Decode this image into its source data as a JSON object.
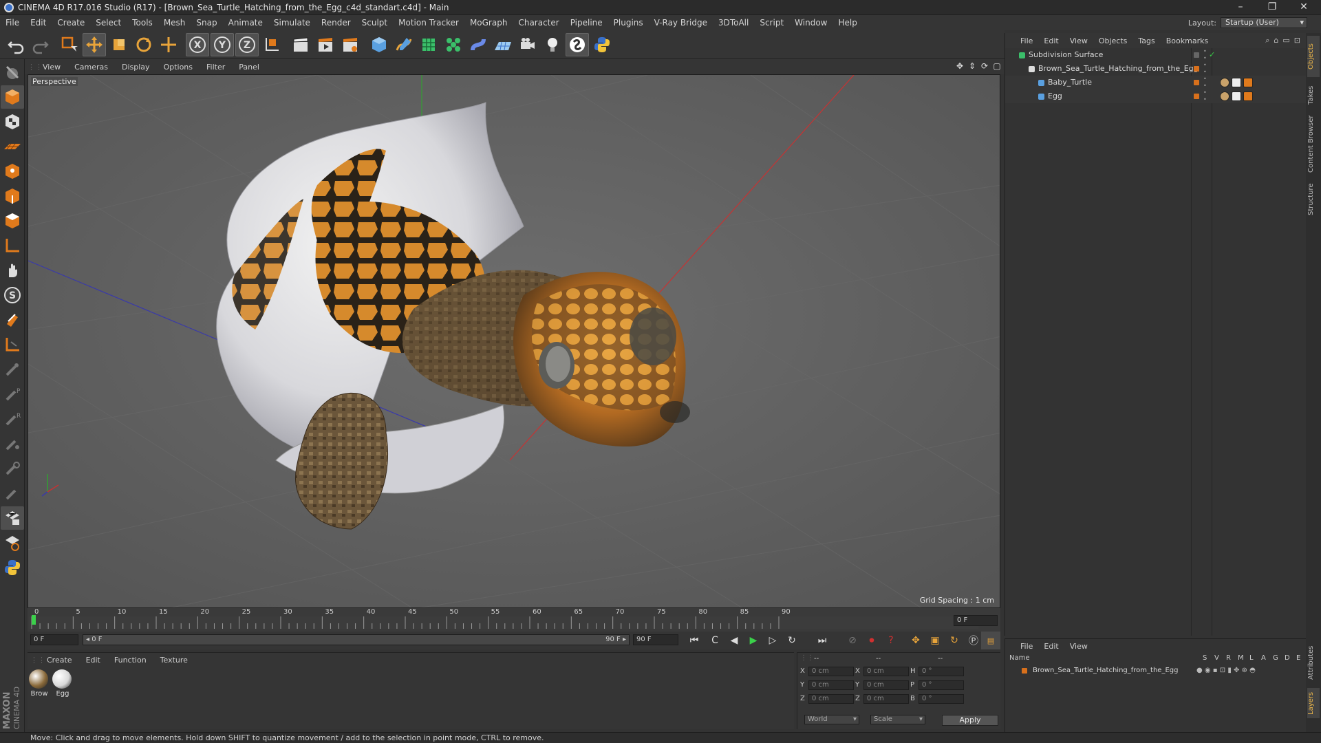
{
  "window": {
    "title": "CINEMA 4D R17.016 Studio (R17) - [Brown_Sea_Turtle_Hatching_from_the_Egg_c4d_standart.c4d] - Main",
    "minimize": "–",
    "maximize": "❐",
    "close": "✕"
  },
  "menubar": {
    "items": [
      "File",
      "Edit",
      "Create",
      "Select",
      "Tools",
      "Mesh",
      "Snap",
      "Animate",
      "Simulate",
      "Render",
      "Sculpt",
      "Motion Tracker",
      "MoGraph",
      "Character",
      "Pipeline",
      "Plugins",
      "V-Ray Bridge",
      "3DToAll",
      "Script",
      "Window",
      "Help"
    ],
    "layout_label": "Layout:",
    "layout_value": "Startup (User)"
  },
  "viewport": {
    "menu": [
      "View",
      "Cameras",
      "Display",
      "Options",
      "Filter",
      "Panel"
    ],
    "label": "Perspective",
    "grid_spacing": "Grid Spacing : 1 cm"
  },
  "timeline": {
    "ticks": [
      "0",
      "5",
      "10",
      "15",
      "20",
      "25",
      "30",
      "35",
      "40",
      "45",
      "50",
      "55",
      "60",
      "65",
      "70",
      "75",
      "80",
      "85",
      "90"
    ],
    "current_frame": "0 F",
    "start_field": "0 F",
    "range_start": "◂ 0 F",
    "range_end": "90 F ▸",
    "end_field": "90 F"
  },
  "materials": {
    "menu": [
      "Create",
      "Edit",
      "Function",
      "Texture"
    ],
    "items": [
      {
        "label": "Brow",
        "color": "#8a6a3a"
      },
      {
        "label": "Egg",
        "color": "#d8d8d8"
      }
    ]
  },
  "coords": {
    "header": [
      "--",
      "--",
      "--"
    ],
    "rows": [
      {
        "a": "X",
        "av": "0 cm",
        "b": "X",
        "bv": "0 cm",
        "c": "H",
        "cv": "0 °"
      },
      {
        "a": "Y",
        "av": "0 cm",
        "b": "Y",
        "bv": "0 cm",
        "c": "P",
        "cv": "0 °"
      },
      {
        "a": "Z",
        "av": "0 cm",
        "b": "Z",
        "bv": "0 cm",
        "c": "B",
        "cv": "0 °"
      }
    ],
    "space": "World",
    "mode": "Scale",
    "apply": "Apply"
  },
  "objects": {
    "menu": [
      "File",
      "Edit",
      "View",
      "Objects",
      "Tags",
      "Bookmarks"
    ],
    "tree": [
      {
        "name": "Subdivision Surface",
        "indent": 0
      },
      {
        "name": "Brown_Sea_Turtle_Hatching_from_the_Egg",
        "indent": 1
      },
      {
        "name": "Baby_Turtle",
        "indent": 2
      },
      {
        "name": "Egg",
        "indent": 2
      }
    ]
  },
  "layers": {
    "menu": [
      "File",
      "Edit",
      "View"
    ],
    "columns": [
      "Name",
      "S",
      "V",
      "R",
      "M",
      "L",
      "A",
      "G",
      "D",
      "E"
    ],
    "row": "Brown_Sea_Turtle_Hatching_from_the_Egg"
  },
  "sidetabs": [
    "Objects",
    "Takes",
    "Content Browser",
    "Structure",
    "Attributes",
    "Layers"
  ],
  "brand": {
    "line1": "MAXON",
    "line2": "CINEMA 4D"
  },
  "status": "Move: Click and drag to move elements. Hold down SHIFT to quantize movement / add to the selection in point mode, CTRL to remove.",
  "colors": {
    "accent": "#e07a1c",
    "ui_bg": "#353535",
    "viewport_bg": "#5e5e5e",
    "x_axis": "#c83232",
    "y_axis": "#32a032",
    "z_axis": "#3232c8"
  }
}
